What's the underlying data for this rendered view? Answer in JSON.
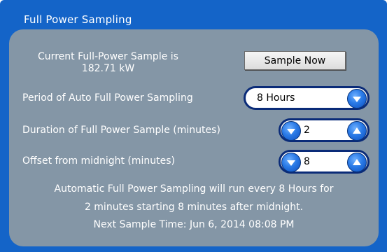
{
  "panel": {
    "title": "Full Power Sampling"
  },
  "current_sample": {
    "label_line1": "Current Full-Power Sample is",
    "label_line2": "182.71 kW",
    "button_label": "Sample Now"
  },
  "period": {
    "label": "Period of Auto Full Power Sampling",
    "value": "8 Hours"
  },
  "duration": {
    "label": "Duration of Full Power Sample (minutes)",
    "value": "2"
  },
  "offset": {
    "label": "Offset from midnight (minutes)",
    "value": "8"
  },
  "info": {
    "line1": "Automatic Full Power Sampling will run every 8 Hours for",
    "line2": "2 minutes starting 8 minutes after midnight.",
    "line3": "Next Sample Time: Jun 6, 2014 08:08 PM"
  },
  "colors": {
    "frame_blue": "#1464c8",
    "panel_gray": "#8496a6",
    "control_border": "#0a2b78",
    "button_blue": "#2a7ae6"
  },
  "icons": {
    "dropdown": "chevron-down-icon",
    "decrement": "chevron-down-icon",
    "increment": "chevron-up-icon"
  }
}
